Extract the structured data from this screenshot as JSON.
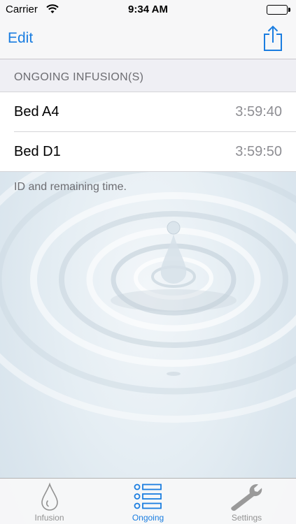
{
  "status_bar": {
    "carrier": "Carrier",
    "time": "9:34 AM"
  },
  "nav": {
    "edit_label": "Edit",
    "share_icon": "share-icon"
  },
  "section": {
    "header": "ONGOING INFUSION(S)",
    "footer": "ID and remaining time."
  },
  "infusions": [
    {
      "id": "Bed A4",
      "remaining": "3:59:40"
    },
    {
      "id": "Bed D1",
      "remaining": "3:59:50"
    }
  ],
  "tabs": [
    {
      "label": "Infusion",
      "icon": "droplet-icon",
      "active": false
    },
    {
      "label": "Ongoing",
      "icon": "list-icon",
      "active": true
    },
    {
      "label": "Settings",
      "icon": "wrench-icon",
      "active": false
    }
  ],
  "colors": {
    "accent": "#1a7de0",
    "inactive": "#929292"
  }
}
